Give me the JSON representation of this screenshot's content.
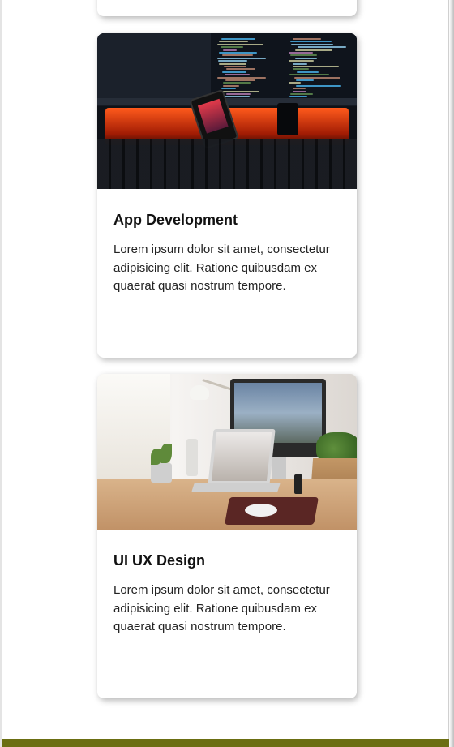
{
  "cards": [
    {
      "image_alt": "Developer desk with monitors showing code and a phone",
      "title": "App Development",
      "text": "Lorem ipsum dolor sit amet, consectetur adipisicing elit. Ratione quibusdam ex quaerat quasi nostrum tempore."
    },
    {
      "image_alt": "Designer desk with an iMac, laptop and plants",
      "title": "UI UX Design",
      "text": "Lorem ipsum dolor sit amet, consectetur adipisicing elit. Ratione quibusdam ex quaerat quasi nostrum tempore."
    }
  ],
  "colors": {
    "footer": "#6b6e12",
    "card_bg": "#ffffff",
    "title": "#111111"
  }
}
